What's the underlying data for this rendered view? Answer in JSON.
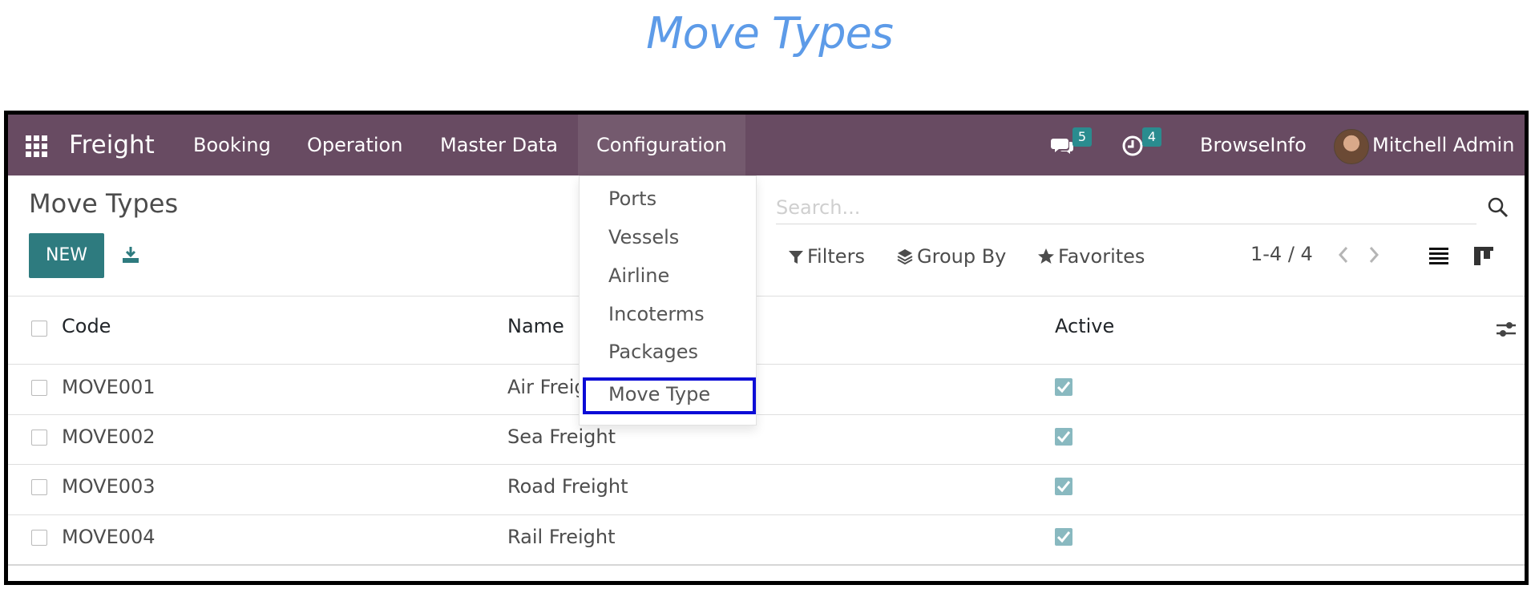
{
  "heading": "Move Types",
  "navbar": {
    "brand": "Freight",
    "menu": [
      "Booking",
      "Operation",
      "Master Data",
      "Configuration"
    ],
    "messages_count": "5",
    "activities_count": "4",
    "company": "BrowseInfo",
    "user": "Mitchell Admin",
    "color": "#684b62"
  },
  "control_panel": {
    "title": "Move Types",
    "new_label": "NEW",
    "search_placeholder": "Search...",
    "filters_label": "Filters",
    "group_by_label": "Group By",
    "favorites_label": "Favorites",
    "pager": "1-4 / 4"
  },
  "table": {
    "columns": [
      "Code",
      "Name",
      "Active"
    ],
    "rows": [
      {
        "code": "MOVE001",
        "name": "Air Freight",
        "active": true
      },
      {
        "code": "MOVE002",
        "name": "Sea Freight",
        "active": true
      },
      {
        "code": "MOVE003",
        "name": "Road Freight",
        "active": true
      },
      {
        "code": "MOVE004",
        "name": "Rail Freight",
        "active": true
      }
    ]
  },
  "dropdown": {
    "items": [
      "Ports",
      "Vessels",
      "Airline",
      "Incoterms",
      "Packages",
      "Move Type"
    ],
    "highlighted": "Move Type",
    "highlight_color": "#0c0cd6"
  }
}
